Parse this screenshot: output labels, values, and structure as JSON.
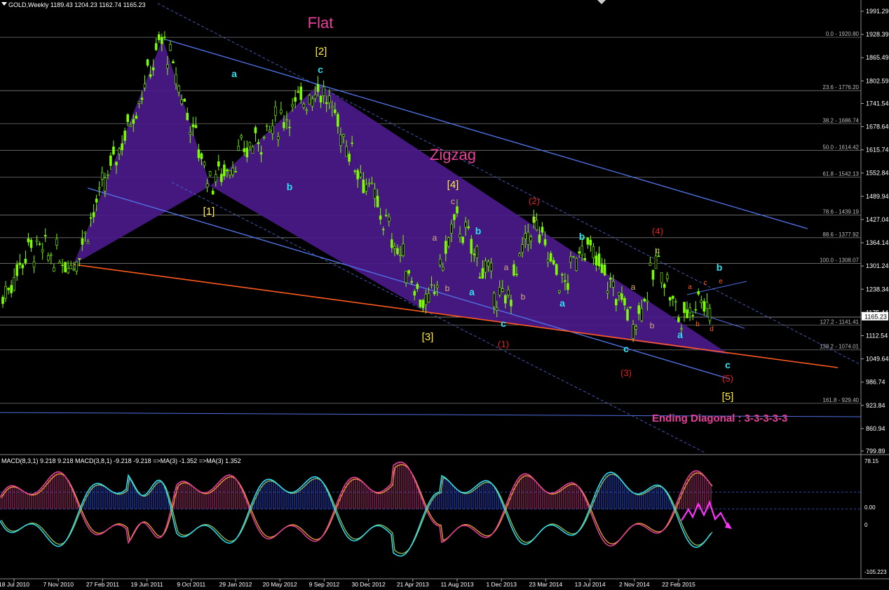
{
  "header": {
    "symbol": "GOLD,Weekly",
    "ohlc": "1189.43 1204.23 1162.74 1165.23"
  },
  "macd_header": "MACD(8,3,1) 9.218 9.218  MACD(3,8,1) -9.218 -9.218  =>MA(3) -1.352  =>MA(3) 1.352",
  "price_axis": [
    "1991.29",
    "1928.39",
    "1865.49",
    "1802.59",
    "1741.54",
    "1678.64",
    "1615.74",
    "1552.84",
    "1489.94",
    "1427.04",
    "1364.14",
    "1301.24",
    "1238.34",
    "1175.44",
    "1112.54",
    "1049.64",
    "986.74",
    "923.84",
    "860.94",
    "799.89"
  ],
  "current_price": "1165.23",
  "macd_axis": [
    "78.15",
    "0.00",
    "0",
    "-105.223"
  ],
  "time_axis": [
    "18 Jul 2010",
    "7 Nov 2010",
    "27 Feb 2011",
    "19 Jun 2011",
    "9 Oct 2011",
    "29 Jan 2012",
    "20 May 2012",
    "9 Sep 2012",
    "30 Dec 2012",
    "21 Apr 2013",
    "11 Aug 2013",
    "1 Dec 2013",
    "23 Mar 2014",
    "13 Jul 2014",
    "2 Nov 2014",
    "22 Feb 2015"
  ],
  "fib_levels": [
    "0.0 - 1920.80",
    "23.6 - 1776.20",
    "38.2 - 1686.74",
    "50.0 - 1614.42",
    "61.8 - 1542.13",
    "78.6 - 1439.19",
    "88.6 - 1377.92",
    "100.0 - 1308.07",
    "127.2 - 1141.41",
    "138.2 - 1074.01",
    "161.8 - 929.40"
  ],
  "annotations": {
    "flat": "Flat",
    "zigzag": "Zigzag",
    "ending": "Ending Diagonal : 3-3-3-3-3",
    "wave1": "[1]",
    "wave2": "[2]",
    "wave3": "[3]",
    "wave4": "[4]",
    "wave5": "[5]",
    "p1": "(1)",
    "p2": "(2)",
    "p3": "(3)",
    "p4": "(4)",
    "p5": "(5)",
    "a": "a",
    "b": "b",
    "c": "c",
    "d": "d",
    "e": "e"
  },
  "colors": {
    "background": "#000000",
    "candle": "#7CFC00",
    "fill": "#4B1A8A",
    "channel": "#4F6FE0",
    "orange": "#FF5A1E",
    "pink": "#E8409A",
    "yellow": "#FFEB3B",
    "cyan": "#2DE1F0",
    "red": "#E02020",
    "tan": "#D9B07A"
  },
  "chart_data": {
    "type": "candlestick",
    "timeframe": "Weekly",
    "ylim": [
      799.89,
      1991.29
    ],
    "wave_points": [
      {
        "label": "start",
        "date": "2010-12",
        "price": 1310
      },
      {
        "label": "[1]",
        "date": "2011-09",
        "price": 1920
      },
      {
        "label": "[1] end",
        "date": "2012-01",
        "price": 1530
      },
      {
        "label": "[2]",
        "date": "2012-10",
        "price": 1790
      },
      {
        "label": "[3]",
        "date": "2013-06",
        "price": 1180
      },
      {
        "label": "[4]",
        "date": "2013-08",
        "price": 1430
      },
      {
        "label": "[5]",
        "date": "2015-07",
        "price": 1075
      }
    ]
  }
}
